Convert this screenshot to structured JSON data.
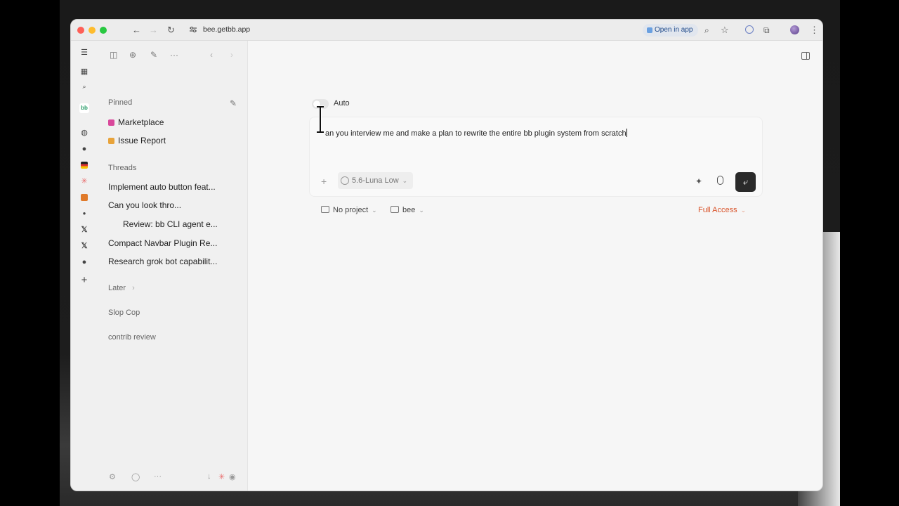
{
  "browser": {
    "url": "bee.getbb.app",
    "open_in_app_label": "Open in app"
  },
  "sidebar": {
    "pinned_heading": "Pinned",
    "pinned": [
      {
        "label": "Marketplace",
        "emoji_color": "#d9489b"
      },
      {
        "label": "Issue Report",
        "emoji_color": "#e8a33a"
      }
    ],
    "threads_heading": "Threads",
    "threads": [
      {
        "label": "Implement auto button feat..."
      },
      {
        "label": "Can you look thro..."
      },
      {
        "label": "Review: bb CLI agent e..."
      },
      {
        "label": "Compact Navbar Plugin Re..."
      },
      {
        "label": "Research grok bot capabilit..."
      }
    ],
    "later_label": "Later",
    "groups": [
      "Slop Cop",
      "contrib review"
    ]
  },
  "main": {
    "auto_label": "Auto",
    "prompt_text": "an you interview me and make a plan to rewrite the entire bb plugin system from scratch",
    "model_label": "5.6-Luna Low",
    "project_label": "No project",
    "workspace_label": "bee",
    "access_label": "Full Access"
  },
  "colors": {
    "accent_send": "#2a2a2a",
    "access": "#d9542b"
  }
}
